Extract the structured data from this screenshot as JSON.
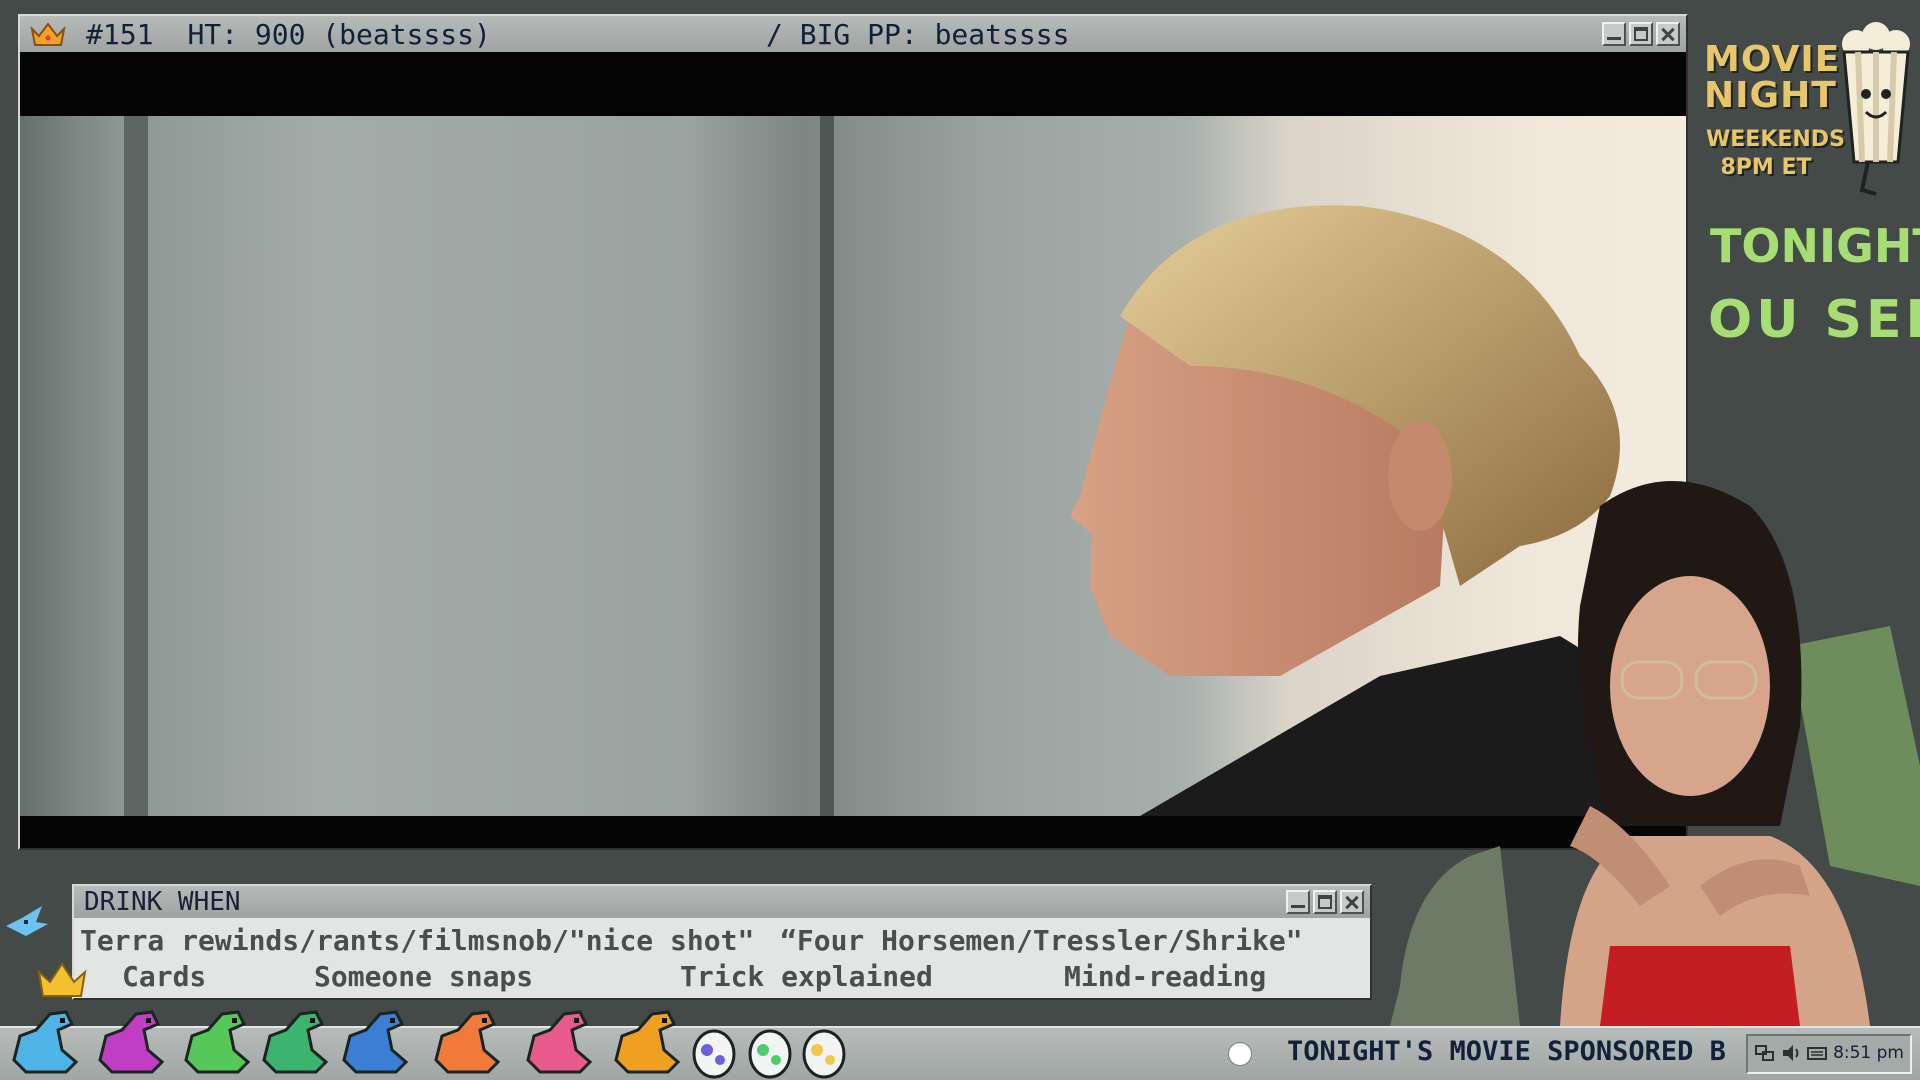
{
  "main_window": {
    "rank": "#151",
    "ht": "HT: 900 (beatssss)",
    "big_pp": "/ BIG PP: beatssss"
  },
  "promo": {
    "title_line1": "MOVIE",
    "title_line2": "NIGHT",
    "subtitle_line1": "WEEKENDS",
    "subtitle_line2": "8PM ET",
    "tonight_label": "TONIGHT:",
    "tonight_title_fragment": "OU SEE"
  },
  "drink_when": {
    "title": "DRINK WHEN",
    "items_row1": [
      "Terra rewinds/rants/filmsnob/\"nice shot\"",
      "“Four Horsemen/Tressler/Shrike\""
    ],
    "items_row2": [
      "Cards",
      "Someone snaps",
      "Trick explained",
      "Mind-reading"
    ]
  },
  "taskbar": {
    "ticker": "TONIGHT'S MOVIE SPONSORED B",
    "clock": "8:51 pm"
  },
  "colors": {
    "accent_gold": "#e8c66a",
    "accent_green": "#a6dd74",
    "chrome": "#a0a6a3",
    "title_text": "#10213a"
  },
  "icons": [
    "crown-icon",
    "minimize-icon",
    "maximize-icon",
    "close-icon",
    "record-dot-icon",
    "network-icon",
    "volume-icon",
    "keyboard-icon"
  ]
}
